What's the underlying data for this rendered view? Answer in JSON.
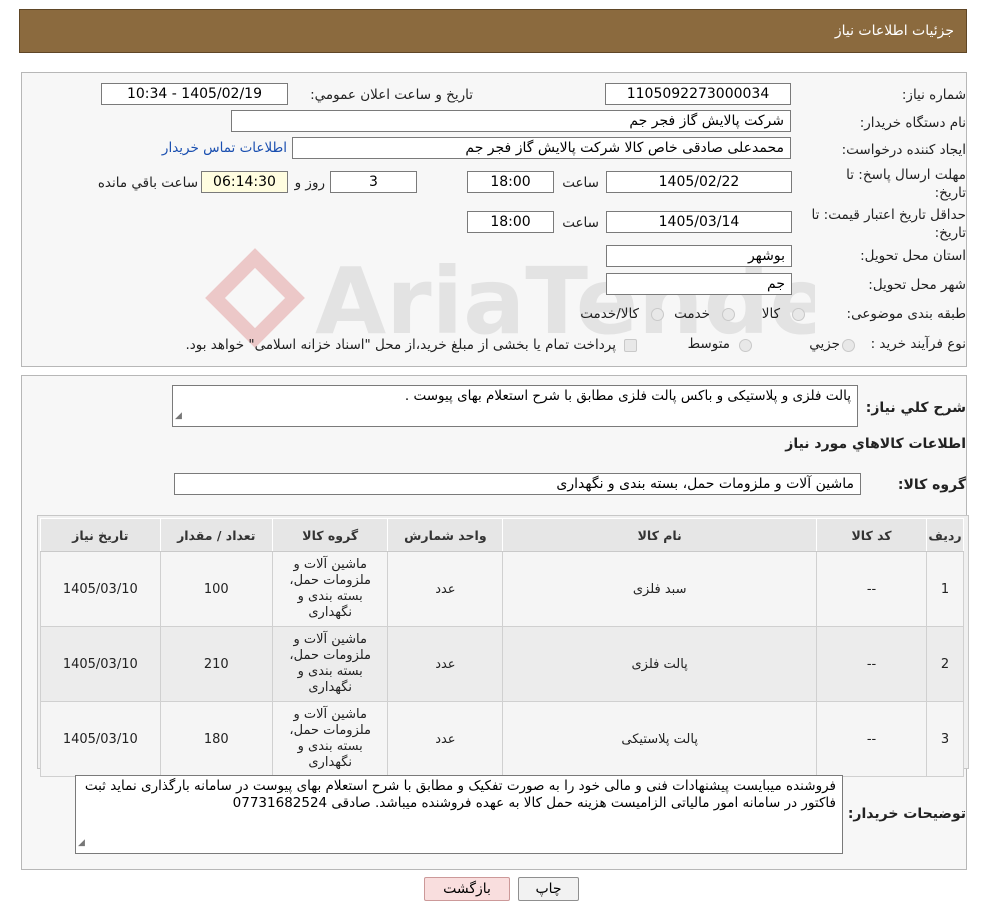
{
  "header": {
    "title": "جزئیات اطلاعات نیاز"
  },
  "watermark": {
    "text": "AriaTender.neT"
  },
  "form": {
    "need_number_label": "شماره نیاز:",
    "need_number": "1105092273000034",
    "announce_label": "تاریخ و ساعت اعلان عمومي:",
    "announce_value": "1405/02/19 - 10:34",
    "buyer_org_label": "نام دستگاه خريدار:",
    "buyer_org": "شرکت پالایش گاز فجر جم",
    "creator_label": "ايجاد کننده درخواست:",
    "creator": "محمدعلی صادقی خاص کالا شرکت پالایش گاز فجر جم",
    "contact_link": "اطلاعات تماس خريدار",
    "deadline_label": "مهلت ارسال پاسخ: تا تاريخ:",
    "deadline_date": "1405/02/22",
    "time_label": "ساعت",
    "deadline_time": "18:00",
    "days_value": "3",
    "days_label": "روز و",
    "remaining_value": "06:14:30",
    "remaining_label": "ساعت باقي مانده",
    "validity_label": "حداقل تاريخ اعتبار قيمت: تا تاريخ:",
    "validity_date": "1405/03/14",
    "validity_time": "18:00",
    "province_label": "استان محل تحويل:",
    "province": "بوشهر",
    "city_label": "شهر محل تحويل:",
    "city": "جم",
    "category_label": "طبقه بندی موضوعی:",
    "category_options": [
      "کالا",
      "خدمت",
      "کالا/خدمت"
    ],
    "process_label": "نوع فرآيند خريد :",
    "process_options": [
      "جزيي",
      "متوسط"
    ],
    "process_note": "پرداخت تمام يا بخشی از مبلغ خريد،از محل \"اسناد خزانه اسلامی\" خواهد بود."
  },
  "details": {
    "summary_label": "شرح کلي نياز:",
    "summary": "پالت فلزی و پلاستیکی و باکس پالت فلزی مطابق با شرح استعلام بهای پیوست .",
    "goods_info_title": "اطلاعات کالاهاي مورد نياز",
    "goods_group_label": "گروه کالا:",
    "goods_group": "ماشین آلات و ملزومات حمل، بسته بندی و نگهداری"
  },
  "table": {
    "headers": [
      "رديف",
      "کد کالا",
      "نام کالا",
      "واحد شمارش",
      "گروه کالا",
      "تعداد / مقدار",
      "تاريخ نياز"
    ],
    "rows": [
      {
        "row": "1",
        "code": "--",
        "name": "سبد فلزی",
        "unit": "عدد",
        "group": "ماشین آلات و ملزومات حمل، بسته بندی و نگهداری",
        "qty": "100",
        "date": "1405/03/10"
      },
      {
        "row": "2",
        "code": "--",
        "name": "پالت فلزی",
        "unit": "عدد",
        "group": "ماشین آلات و ملزومات حمل، بسته بندی و نگهداری",
        "qty": "210",
        "date": "1405/03/10"
      },
      {
        "row": "3",
        "code": "--",
        "name": "پالت پلاستیکی",
        "unit": "عدد",
        "group": "ماشین آلات و ملزومات حمل، بسته بندی و نگهداری",
        "qty": "180",
        "date": "1405/03/10"
      }
    ]
  },
  "buyer_notes": {
    "label": "توضيحات خريدار:",
    "text": "فروشنده میبایست پیشنهادات فنی و مالی خود را به صورت تفکیک و مطابق با شرح استعلام بهای پیوست در سامانه بارگذاری نماید ثبت فاکتور در سامانه امور مالیاتی الزامیست هزینه حمل کالا به عهده فروشنده میباشد. صادقی 07731682524"
  },
  "buttons": {
    "print": "چاپ",
    "back": "بازگشت"
  }
}
